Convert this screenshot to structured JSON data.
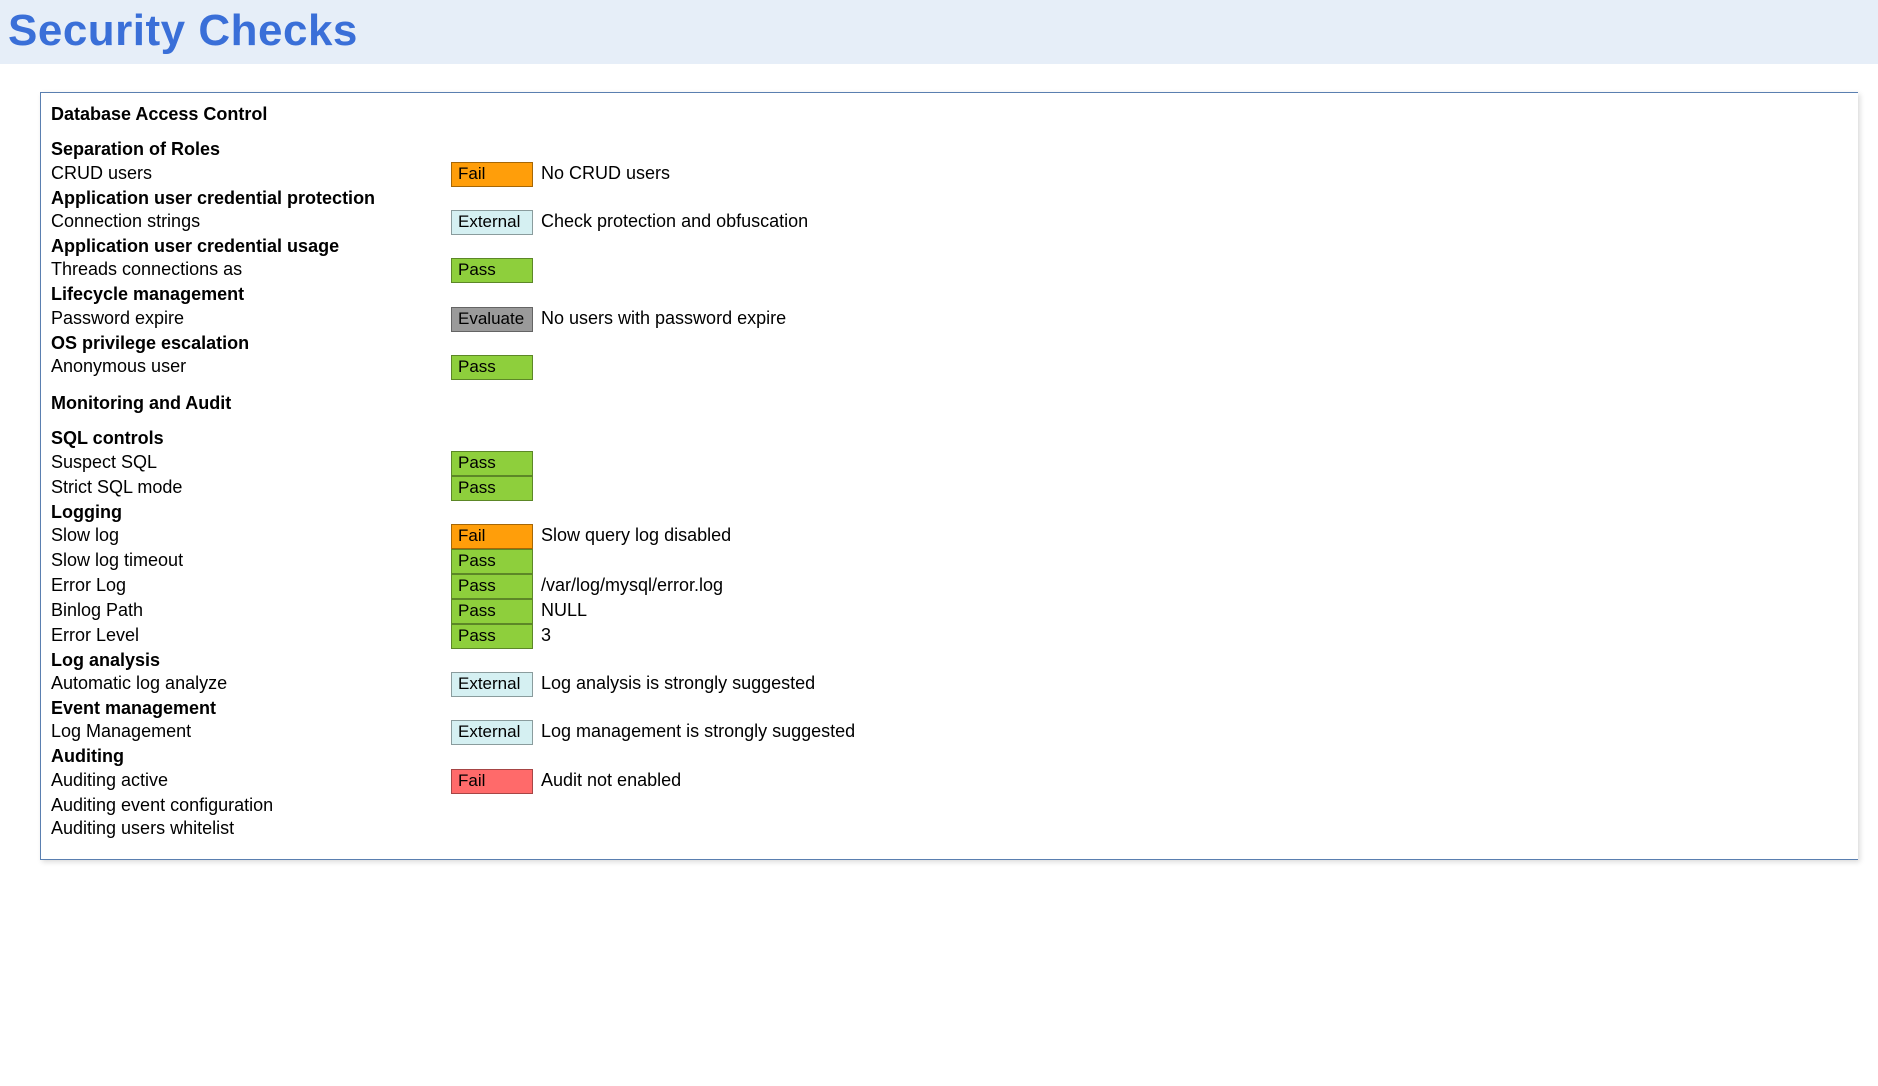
{
  "header": {
    "title": "Security Checks"
  },
  "sections": [
    {
      "title": "Database Access Control",
      "groups": [
        {
          "title": "Separation of Roles",
          "rows": [
            {
              "label": "CRUD users",
              "status": "Fail",
              "variant": "FailO",
              "detail": "No CRUD users"
            }
          ]
        },
        {
          "title": "Application user credential protection",
          "rows": [
            {
              "label": "Connection strings",
              "status": "External",
              "variant": "External",
              "detail": "Check protection and obfuscation"
            }
          ]
        },
        {
          "title": "Application user credential usage",
          "rows": [
            {
              "label": "Threads connections as",
              "status": "Pass",
              "variant": "Pass",
              "detail": ""
            }
          ]
        },
        {
          "title": "Lifecycle management",
          "rows": [
            {
              "label": "Password expire",
              "status": "Evaluate",
              "variant": "Evaluate",
              "detail": "No users with password expire"
            }
          ]
        },
        {
          "title": "OS privilege escalation",
          "rows": [
            {
              "label": "Anonymous user",
              "status": "Pass",
              "variant": "Pass",
              "detail": ""
            }
          ]
        }
      ]
    },
    {
      "title": "Monitoring and Audit",
      "groups": [
        {
          "title": "SQL controls",
          "rows": [
            {
              "label": "Suspect SQL",
              "status": "Pass",
              "variant": "Pass",
              "detail": ""
            },
            {
              "label": "Strict SQL mode",
              "status": "Pass",
              "variant": "Pass",
              "detail": ""
            }
          ]
        },
        {
          "title": "Logging",
          "rows": [
            {
              "label": "Slow log",
              "status": "Fail",
              "variant": "FailO",
              "detail": "Slow query log disabled"
            },
            {
              "label": "Slow log timeout",
              "status": "Pass",
              "variant": "Pass",
              "detail": ""
            },
            {
              "label": "Error Log",
              "status": "Pass",
              "variant": "Pass",
              "detail": "/var/log/mysql/error.log"
            },
            {
              "label": "Binlog Path",
              "status": "Pass",
              "variant": "Pass",
              "detail": "NULL"
            },
            {
              "label": "Error Level",
              "status": "Pass",
              "variant": "Pass",
              "detail": "3"
            }
          ]
        },
        {
          "title": "Log analysis",
          "rows": [
            {
              "label": "Automatic log analyze",
              "status": "External",
              "variant": "External",
              "detail": "Log analysis is strongly suggested"
            }
          ]
        },
        {
          "title": "Event management",
          "rows": [
            {
              "label": "Log Management",
              "status": "External",
              "variant": "External",
              "detail": "Log management is strongly suggested"
            }
          ]
        },
        {
          "title": "Auditing",
          "rows": [
            {
              "label": "Auditing active",
              "status": "Fail",
              "variant": "FailR",
              "detail": "Audit not enabled"
            },
            {
              "label": "Auditing event configuration",
              "status": "",
              "variant": "",
              "detail": ""
            },
            {
              "label": "Auditing users whitelist",
              "status": "",
              "variant": "",
              "detail": ""
            }
          ]
        }
      ]
    }
  ]
}
